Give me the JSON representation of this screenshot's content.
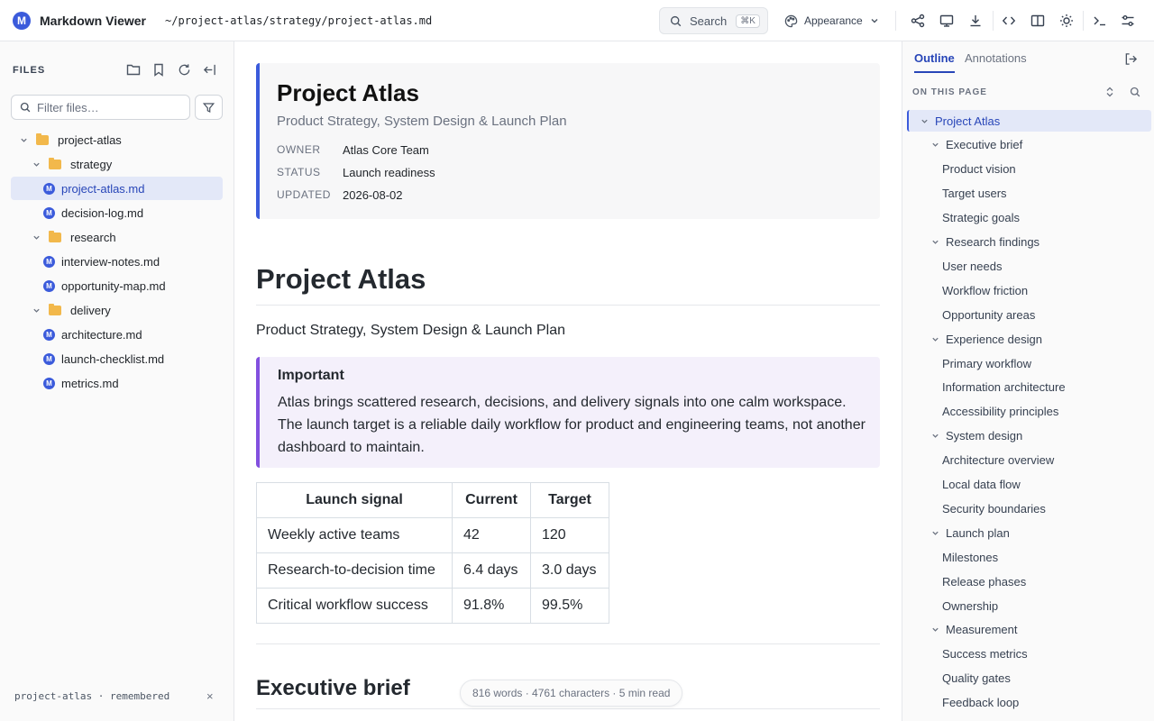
{
  "app": {
    "title": "Markdown Viewer",
    "logo_letter": "M",
    "path": "~/project-atlas/strategy/project-atlas.md"
  },
  "topbar": {
    "search_label": "Search",
    "search_shortcut": "⌘K",
    "appearance_label": "Appearance",
    "icons": [
      "graph-icon",
      "presentation-icon",
      "download-icon",
      "code-icon",
      "columns-icon",
      "theme-sun-icon",
      "terminal-icon",
      "settings-sliders-icon"
    ]
  },
  "sidebar": {
    "heading": "FILES",
    "filter_placeholder": "Filter files…",
    "tree": [
      {
        "type": "folder",
        "label": "project-atlas",
        "depth": 0
      },
      {
        "type": "folder",
        "label": "strategy",
        "depth": 1
      },
      {
        "type": "file",
        "label": "project-atlas.md",
        "depth": 2,
        "active": true
      },
      {
        "type": "file",
        "label": "decision-log.md",
        "depth": 2
      },
      {
        "type": "folder",
        "label": "research",
        "depth": 1
      },
      {
        "type": "file",
        "label": "interview-notes.md",
        "depth": 2
      },
      {
        "type": "file",
        "label": "opportunity-map.md",
        "depth": 2
      },
      {
        "type": "folder",
        "label": "delivery",
        "depth": 1
      },
      {
        "type": "file",
        "label": "architecture.md",
        "depth": 2
      },
      {
        "type": "file",
        "label": "launch-checklist.md",
        "depth": 2
      },
      {
        "type": "file",
        "label": "metrics.md",
        "depth": 2
      }
    ],
    "footer": "project-atlas · remembered",
    "footer_close": "×"
  },
  "document": {
    "frontmatter": {
      "title": "Project Atlas",
      "subtitle": "Product Strategy, System Design & Launch Plan",
      "rows": [
        {
          "key": "OWNER",
          "value": "Atlas Core Team"
        },
        {
          "key": "STATUS",
          "value": "Launch readiness"
        },
        {
          "key": "UPDATED",
          "value": "2026-08-02"
        }
      ]
    },
    "h1": "Project Atlas",
    "lead": "Product Strategy, System Design & Launch Plan",
    "callout": {
      "title": "Important",
      "text": "Atlas brings scattered research, decisions, and delivery signals into one calm workspace. The launch target is a reliable daily workflow for product and engineering teams, not another dashboard to maintain."
    },
    "table": {
      "headers": [
        "Launch signal",
        "Current",
        "Target"
      ],
      "rows": [
        [
          "Weekly active teams",
          "42",
          "120"
        ],
        [
          "Research-to-decision time",
          "6.4 days",
          "3.0 days"
        ],
        [
          "Critical workflow success",
          "91.8%",
          "99.5%"
        ]
      ]
    },
    "h2": "Executive brief",
    "stats": "816 words · 4761 characters · 5 min read"
  },
  "outline": {
    "tabs": [
      "Outline",
      "Annotations"
    ],
    "heading": "ON THIS PAGE",
    "items": [
      {
        "label": "Project Atlas",
        "level": 1,
        "active": true
      },
      {
        "label": "Executive brief",
        "level": 2
      },
      {
        "label": "Product vision",
        "level": 3
      },
      {
        "label": "Target users",
        "level": 3
      },
      {
        "label": "Strategic goals",
        "level": 3
      },
      {
        "label": "Research findings",
        "level": 2
      },
      {
        "label": "User needs",
        "level": 3
      },
      {
        "label": "Workflow friction",
        "level": 3
      },
      {
        "label": "Opportunity areas",
        "level": 3
      },
      {
        "label": "Experience design",
        "level": 2
      },
      {
        "label": "Primary workflow",
        "level": 3
      },
      {
        "label": "Information architecture",
        "level": 3
      },
      {
        "label": "Accessibility principles",
        "level": 3
      },
      {
        "label": "System design",
        "level": 2
      },
      {
        "label": "Architecture overview",
        "level": 3
      },
      {
        "label": "Local data flow",
        "level": 3
      },
      {
        "label": "Security boundaries",
        "level": 3
      },
      {
        "label": "Launch plan",
        "level": 2
      },
      {
        "label": "Milestones",
        "level": 3
      },
      {
        "label": "Release phases",
        "level": 3
      },
      {
        "label": "Ownership",
        "level": 3
      },
      {
        "label": "Measurement",
        "level": 2
      },
      {
        "label": "Success metrics",
        "level": 3
      },
      {
        "label": "Quality gates",
        "level": 3
      },
      {
        "label": "Feedback loop",
        "level": 3
      }
    ]
  }
}
